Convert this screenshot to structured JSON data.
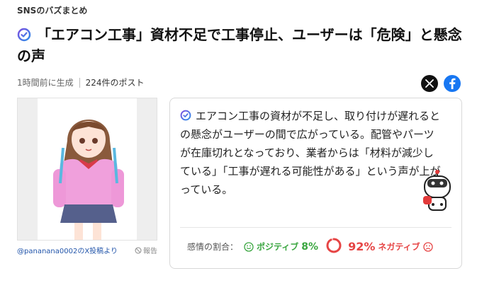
{
  "category": "SNSのバズまとめ",
  "headline": "「エアコン工事」資材不足で工事停止、ユーザーは「危険」と懸念の声",
  "meta": {
    "time": "1時間前に生成",
    "posts": "224件のポスト"
  },
  "share": {
    "x_icon": "x-logo-icon",
    "fb_icon": "facebook-logo-icon"
  },
  "image": {
    "caption": "@pananana0002のX投稿より",
    "report": "報告"
  },
  "summary": {
    "text": "エアコン工事の資材が不足し、取り付けが遅れるとの懸念がユーザーの間で広がっている。配管やパーツが在庫切れとなっており、業者からは「材料が減少している」「工事が遅れる可能性がある」という声が上がっている。"
  },
  "sentiment": {
    "label": "感情の割合：",
    "positive_label": "ポジティブ",
    "positive_pct": "8%",
    "negative_pct": "92%",
    "negative_label": "ネガティブ",
    "negative_fraction": 0.92
  },
  "colors": {
    "positive": "#3aa640",
    "negative": "#e64545",
    "brand_bolt": "#2f6fe0"
  }
}
